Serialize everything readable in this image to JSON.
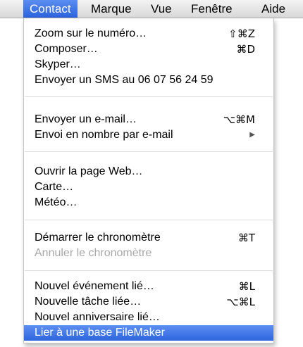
{
  "menubar": {
    "items": [
      "Contact",
      "Marque",
      "Vue",
      "Fenêtre",
      "Aide"
    ]
  },
  "menu": {
    "groups": [
      [
        {
          "label": "Zoom sur le numéro…",
          "shortcut": "⇧⌘Z"
        },
        {
          "label": "Composer…",
          "shortcut": "⌘D"
        },
        {
          "label": "Skyper…",
          "shortcut": ""
        },
        {
          "label": "Envoyer un SMS au 06 07 56 24 59",
          "shortcut": ""
        }
      ],
      [
        {
          "label": "Envoyer un e-mail…",
          "shortcut": "⌥⌘M"
        },
        {
          "label": "Envoi en nombre par e-mail",
          "shortcut": "▶"
        }
      ],
      [
        {
          "label": "Ouvrir la page Web…",
          "shortcut": ""
        },
        {
          "label": "Carte…",
          "shortcut": ""
        },
        {
          "label": "Météo…",
          "shortcut": ""
        }
      ],
      [
        {
          "label": "Démarrer le chronomètre",
          "shortcut": "⌘T"
        },
        {
          "label": "Annuler le chronomètre",
          "shortcut": "",
          "disabled": true
        }
      ],
      [
        {
          "label": "Nouvel événement lié…",
          "shortcut": "⌘L"
        },
        {
          "label": "Nouvelle tâche liée…",
          "shortcut": "⌥⌘L"
        },
        {
          "label": "Nouvel anniversaire lié…",
          "shortcut": ""
        },
        {
          "label": "Lier à une base FileMaker",
          "shortcut": "",
          "highlighted": true
        }
      ]
    ]
  },
  "colors": {
    "highlight": "#2c65de",
    "disabled_text": "#a8a8a8"
  }
}
